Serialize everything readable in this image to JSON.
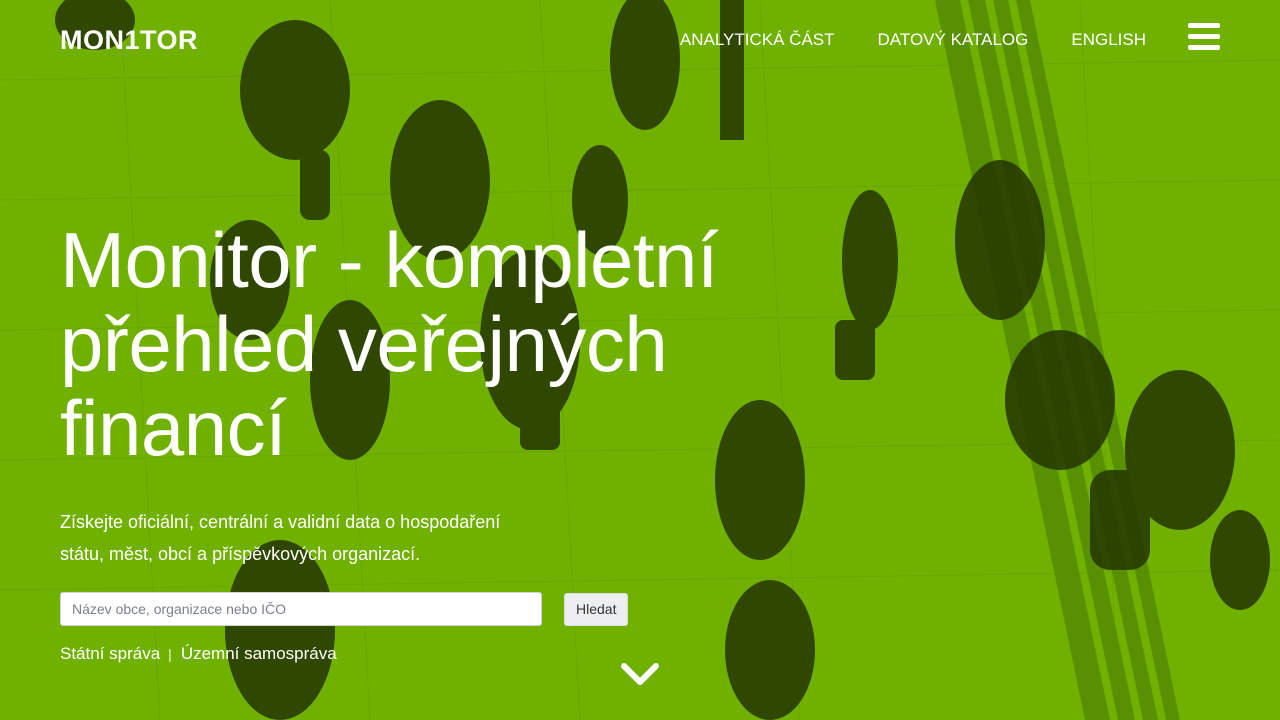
{
  "brand": {
    "logo": "MON1TOR"
  },
  "nav": {
    "items": [
      "ANALYTICKÁ ČÁST",
      "DATOVÝ KATALOG",
      "ENGLISH"
    ],
    "menu_icon": "hamburger-menu-icon"
  },
  "hero": {
    "title": "Monitor - kompletní přehled veřejných financí",
    "subtitle": "Získejte oficiální, centrální a validní data o hospodaření státu, měst, obcí a příspěvkových organizací.",
    "background_color": "#6fb000"
  },
  "search": {
    "placeholder": "Název obce, organizace nebo IČO",
    "value": "",
    "button_label": "Hledat"
  },
  "quick_links": {
    "items": [
      "Státní správa",
      "Územní samospráva"
    ],
    "separator": "|"
  },
  "scroll_icon": "chevron-down-icon"
}
